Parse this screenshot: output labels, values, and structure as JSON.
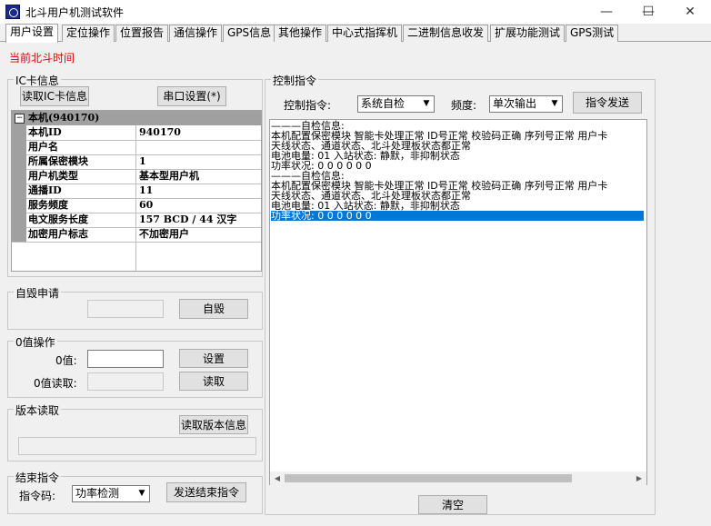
{
  "window": {
    "title": "北斗用户机测试软件",
    "minimize": "—",
    "maximize": "☐",
    "close": "✕"
  },
  "tabs": [
    "用户设置",
    "定位操作",
    "位置报告",
    "通信操作",
    "GPS信息",
    "其他操作",
    "中心式指挥机",
    "二进制信息收发",
    "扩展功能测试",
    "GPS测试"
  ],
  "active_tab": "用户设置",
  "beidou_time_label": "当前北斗时间",
  "ic_card": {
    "title": "IC卡信息",
    "read_button": "读取IC卡信息",
    "serial_button": "串口设置(*)",
    "grid_header": "本机(940170)",
    "toggle": "−",
    "rows": [
      {
        "key": "本机ID",
        "value": "940170"
      },
      {
        "key": "用户名",
        "value": ""
      },
      {
        "key": "所属保密模块",
        "value": "1"
      },
      {
        "key": "用户机类型",
        "value": "基本型用户机"
      },
      {
        "key": "通播ID",
        "value": "11"
      },
      {
        "key": "服务频度",
        "value": "60"
      },
      {
        "key": "电文服务长度",
        "value": "157 BCD / 44 汉字"
      },
      {
        "key": "加密用户标志",
        "value": "不加密用户"
      }
    ]
  },
  "self_destruct": {
    "title": "自毁申请",
    "button": "自毁"
  },
  "zero_value": {
    "title": "0值操作",
    "value_label": "0值:",
    "read_label": "0值读取:",
    "set_button": "设置",
    "read_button": "读取"
  },
  "version": {
    "title": "版本读取",
    "button": "读取版本信息"
  },
  "end_command": {
    "title": "结束指令",
    "code_label": "指令码:",
    "code_value": "功率检测",
    "send_button": "发送结束指令"
  },
  "control": {
    "title": "控制指令",
    "command_label": "控制指令:",
    "command_value": "系统自检",
    "freq_label": "频度:",
    "freq_value": "单次输出",
    "send_button": "指令发送",
    "clear_button": "清空",
    "log": [
      "———自检信息:",
      "本机配置保密模块 智能卡处理正常 ID号正常 校验码正确 序列号正常 用户卡",
      "天线状态、通道状态、北斗处理板状态都正常",
      "电池电量: 01  入站状态: 静默，非抑制状态",
      "功率状况: 0 0 0 0 0 0",
      "———自检信息:",
      "本机配置保密模块 智能卡处理正常 ID号正常 校验码正确 序列号正常 用户卡",
      "天线状态、通道状态、北斗处理板状态都正常",
      "电池电量: 01  入站状态: 静默，非抑制状态",
      "功率状况: 0 0 0 0 0 0"
    ],
    "selected_line": 9
  }
}
